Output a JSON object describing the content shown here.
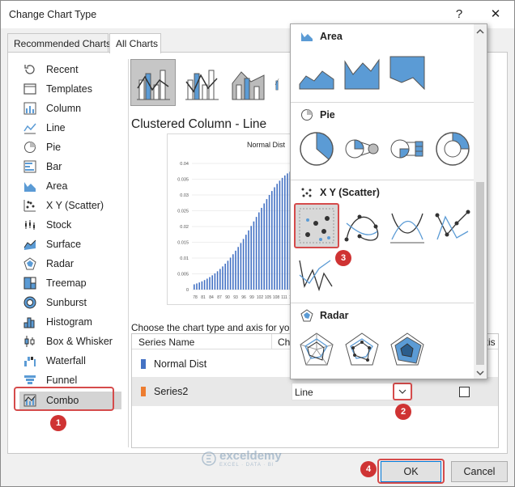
{
  "window": {
    "title": "Change Chart Type",
    "help_glyph": "?",
    "close_glyph": "✕"
  },
  "tabs": [
    {
      "label": "Recommended Charts",
      "active": false
    },
    {
      "label": "All Charts",
      "active": true
    }
  ],
  "sidebar": {
    "items": [
      {
        "label": "Recent",
        "icon": "recent-icon"
      },
      {
        "label": "Templates",
        "icon": "templates-icon"
      },
      {
        "label": "Column",
        "icon": "column-chart-icon"
      },
      {
        "label": "Line",
        "icon": "line-chart-icon"
      },
      {
        "label": "Pie",
        "icon": "pie-chart-icon"
      },
      {
        "label": "Bar",
        "icon": "bar-chart-icon"
      },
      {
        "label": "Area",
        "icon": "area-chart-icon"
      },
      {
        "label": "X Y (Scatter)",
        "icon": "scatter-chart-icon"
      },
      {
        "label": "Stock",
        "icon": "stock-chart-icon"
      },
      {
        "label": "Surface",
        "icon": "surface-chart-icon"
      },
      {
        "label": "Radar",
        "icon": "radar-chart-icon"
      },
      {
        "label": "Treemap",
        "icon": "treemap-chart-icon"
      },
      {
        "label": "Sunburst",
        "icon": "sunburst-chart-icon"
      },
      {
        "label": "Histogram",
        "icon": "histogram-chart-icon"
      },
      {
        "label": "Box & Whisker",
        "icon": "box-whisker-chart-icon"
      },
      {
        "label": "Waterfall",
        "icon": "waterfall-chart-icon"
      },
      {
        "label": "Funnel",
        "icon": "funnel-chart-icon"
      },
      {
        "label": "Combo",
        "icon": "combo-chart-icon",
        "selected": true
      }
    ]
  },
  "main": {
    "chart_title": "Clustered Column - Line",
    "preview_title": "Normal Dist",
    "preview_y_ticks": [
      "0.04",
      "0.035",
      "0.03",
      "0.025",
      "0.02",
      "0.015",
      "0.01",
      "0.005",
      "0"
    ],
    "preview_x_ticks": [
      "78",
      "81",
      "84",
      "87",
      "90",
      "93",
      "96",
      "99",
      "102",
      "105",
      "108",
      "111",
      "114"
    ],
    "choose_text": "Choose the chart type and axis for you",
    "table": {
      "headers": {
        "series": "Series Name",
        "chart": "Cha",
        "axis": "xis"
      },
      "rows": [
        {
          "name": "Normal Dist",
          "color": "#4472c4"
        },
        {
          "name": "Series2",
          "color": "#ed7d31",
          "chart_type": "Line",
          "secondary_axis": false
        }
      ]
    }
  },
  "popup": {
    "sections": [
      {
        "label": "Area",
        "icon": "area-chart-icon"
      },
      {
        "label": "Pie",
        "icon": "pie-chart-icon"
      },
      {
        "label": "X Y (Scatter)",
        "icon": "scatter-chart-icon"
      },
      {
        "label": "Radar",
        "icon": "radar-chart-icon"
      }
    ]
  },
  "buttons": {
    "ok": "OK",
    "cancel": "Cancel"
  },
  "callouts": [
    "1",
    "2",
    "3",
    "4"
  ],
  "watermark": {
    "name": "exceldemy",
    "sub": "EXCEL · DATA · BI"
  },
  "colors": {
    "accent": "#4472c4",
    "highlight": "#d54b4b",
    "series2": "#ed7d31",
    "icon_blue": "#5b9bd5"
  }
}
